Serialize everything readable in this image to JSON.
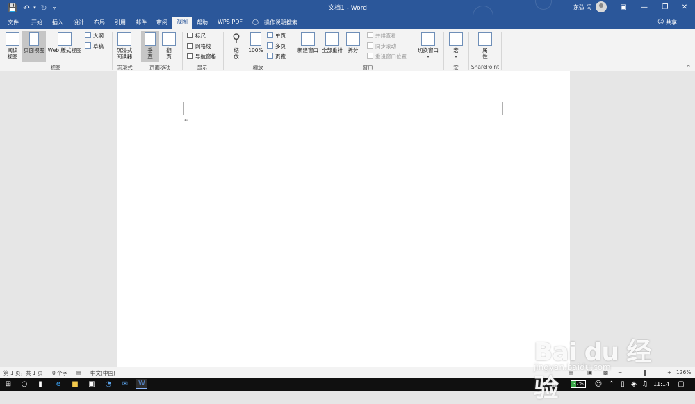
{
  "titlebar": {
    "title": "文档1 - Word",
    "user": "东弘 闫",
    "save_icon": "save-icon",
    "undo_icon": "undo-icon"
  },
  "tabs": [
    {
      "label": "文件"
    },
    {
      "label": "开始"
    },
    {
      "label": "插入"
    },
    {
      "label": "设计"
    },
    {
      "label": "布局"
    },
    {
      "label": "引用"
    },
    {
      "label": "邮件"
    },
    {
      "label": "审阅"
    },
    {
      "label": "视图"
    },
    {
      "label": "帮助"
    },
    {
      "label": "WPS PDF"
    }
  ],
  "tell_me": "操作说明搜索",
  "share": "共享",
  "ribbon": {
    "views": {
      "label": "视图",
      "read_mode": "阅读\n视图",
      "print_layout": "页面视图",
      "web_layout": "Web 版式视图",
      "outline": "大纲",
      "draft": "草稿"
    },
    "immersive": {
      "label": "沉浸式",
      "reader": "沉浸式\n阅读器"
    },
    "page_movement": {
      "label": "页面移动",
      "vertical": "垂\n直",
      "side_to_side": "翻\n页"
    },
    "show": {
      "label": "显示",
      "ruler": "标尺",
      "gridlines": "网格线",
      "nav_pane": "导航窗格"
    },
    "zoom": {
      "label": "缩放",
      "zoom": "缩\n放",
      "hundred": "100%",
      "one_page": "单页",
      "multiple_pages": "多页",
      "page_width": "页宽"
    },
    "window": {
      "label": "窗口",
      "new_window": "新建窗口",
      "arrange_all": "全部重排",
      "split": "拆分",
      "side_by_side": "并排查看",
      "sync_scroll": "同步滚动",
      "reset_position": "重设窗口位置",
      "switch_windows": "切换窗口"
    },
    "macros": {
      "label": "宏",
      "macros": "宏"
    },
    "sharepoint": {
      "label": "SharePoint",
      "properties": "属\n性"
    }
  },
  "document": {
    "para_mark": "↵"
  },
  "statusbar": {
    "page": "第 1 页，共 1 页",
    "words": "0 个字",
    "language": "中文(中国)",
    "zoom": "126%",
    "zoom_minus": "−",
    "zoom_plus": "+"
  },
  "taskbar": {
    "battery": "37%",
    "time": "11:14"
  },
  "watermark": {
    "brand": "Bai du 经验",
    "url": "jingyan.baidu.com"
  }
}
